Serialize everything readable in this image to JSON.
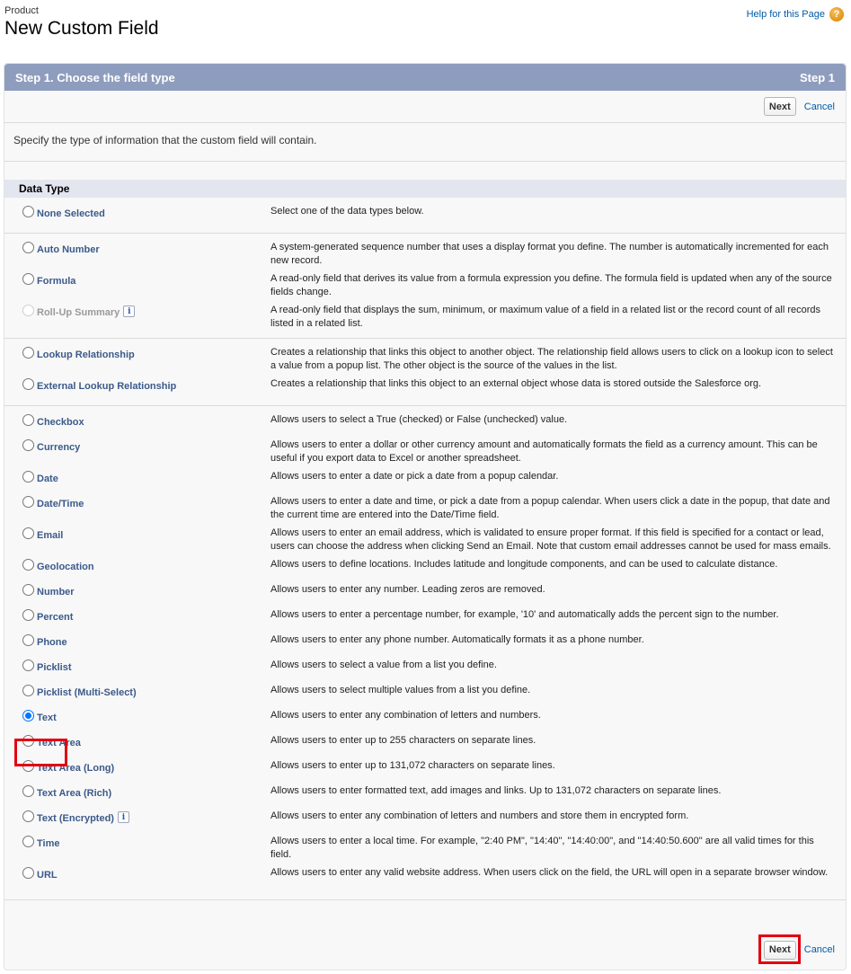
{
  "header": {
    "object_name": "Product",
    "title": "New Custom Field",
    "help_link": "Help for this Page",
    "help_icon": "question-circle-icon"
  },
  "panel": {
    "title": "Step 1. Choose the field type",
    "step": "Step 1",
    "next_label": "Next",
    "cancel_label": "Cancel",
    "instruction": "Specify the type of information that the custom field will contain.",
    "section_title": "Data Type"
  },
  "groups": [
    {
      "items": [
        {
          "label": "None Selected",
          "description": "Select one of the data types below.",
          "selected": false,
          "disabled": false
        }
      ]
    },
    {
      "items": [
        {
          "label": "Auto Number",
          "description": "A system-generated sequence number that uses a display format you define. The number is automatically incremented for each new record.",
          "selected": false,
          "disabled": false
        },
        {
          "label": "Formula",
          "description": "A read-only field that derives its value from a formula expression you define. The formula field is updated when any of the source fields change.",
          "selected": false,
          "disabled": false
        },
        {
          "label": "Roll-Up Summary",
          "description": "A read-only field that displays the sum, minimum, or maximum value of a field in a related list or the record count of all records listed in a related list.",
          "selected": false,
          "disabled": true,
          "info": true
        }
      ]
    },
    {
      "items": [
        {
          "label": "Lookup Relationship",
          "description": "Creates a relationship that links this object to another object. The relationship field allows users to click on a lookup icon to select a value from a popup list. The other object is the source of the values in the list.",
          "selected": false,
          "disabled": false
        },
        {
          "label": "External Lookup Relationship",
          "description": "Creates a relationship that links this object to an external object whose data is stored outside the Salesforce org.",
          "selected": false,
          "disabled": false
        }
      ]
    },
    {
      "items": [
        {
          "label": "Checkbox",
          "description": "Allows users to select a True (checked) or False (unchecked) value.",
          "selected": false,
          "disabled": false
        },
        {
          "label": "Currency",
          "description": "Allows users to enter a dollar or other currency amount and automatically formats the field as a currency amount. This can be useful if you export data to Excel or another spreadsheet.",
          "selected": false,
          "disabled": false
        },
        {
          "label": "Date",
          "description": "Allows users to enter a date or pick a date from a popup calendar.",
          "selected": false,
          "disabled": false
        },
        {
          "label": "Date/Time",
          "description": "Allows users to enter a date and time, or pick a date from a popup calendar. When users click a date in the popup, that date and the current time are entered into the Date/Time field.",
          "selected": false,
          "disabled": false
        },
        {
          "label": "Email",
          "description": "Allows users to enter an email address, which is validated to ensure proper format. If this field is specified for a contact or lead, users can choose the address when clicking Send an Email. Note that custom email addresses cannot be used for mass emails.",
          "selected": false,
          "disabled": false
        },
        {
          "label": "Geolocation",
          "description": "Allows users to define locations. Includes latitude and longitude components, and can be used to calculate distance.",
          "selected": false,
          "disabled": false
        },
        {
          "label": "Number",
          "description": "Allows users to enter any number. Leading zeros are removed.",
          "selected": false,
          "disabled": false
        },
        {
          "label": "Percent",
          "description": "Allows users to enter a percentage number, for example, '10' and automatically adds the percent sign to the number.",
          "selected": false,
          "disabled": false
        },
        {
          "label": "Phone",
          "description": "Allows users to enter any phone number. Automatically formats it as a phone number.",
          "selected": false,
          "disabled": false
        },
        {
          "label": "Picklist",
          "description": "Allows users to select a value from a list you define.",
          "selected": false,
          "disabled": false
        },
        {
          "label": "Picklist (Multi-Select)",
          "description": "Allows users to select multiple values from a list you define.",
          "selected": false,
          "disabled": false
        },
        {
          "label": "Text",
          "description": "Allows users to enter any combination of letters and numbers.",
          "selected": true,
          "disabled": false,
          "highlighted": true
        },
        {
          "label": "Text Area",
          "description": "Allows users to enter up to 255 characters on separate lines.",
          "selected": false,
          "disabled": false
        },
        {
          "label": "Text Area (Long)",
          "description": "Allows users to enter up to 131,072 characters on separate lines.",
          "selected": false,
          "disabled": false
        },
        {
          "label": "Text Area (Rich)",
          "description": "Allows users to enter formatted text, add images and links. Up to 131,072 characters on separate lines.",
          "selected": false,
          "disabled": false
        },
        {
          "label": "Text (Encrypted)",
          "description": "Allows users to enter any combination of letters and numbers and store them in encrypted form.",
          "selected": false,
          "disabled": false,
          "info": true
        },
        {
          "label": "Time",
          "description": "Allows users to enter a local time. For example, \"2:40 PM\", \"14:40\", \"14:40:00\", and \"14:40:50.600\" are all valid times for this field.",
          "selected": false,
          "disabled": false
        },
        {
          "label": "URL",
          "description": "Allows users to enter any valid website address. When users click on the field, the URL will open in a separate browser window.",
          "selected": false,
          "disabled": false
        }
      ]
    }
  ],
  "annotation_color": "#e2000f",
  "accent_color": "#8e9dbe"
}
